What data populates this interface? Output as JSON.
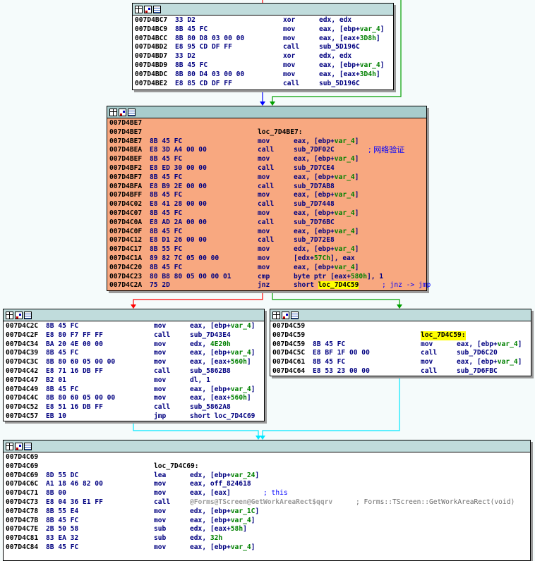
{
  "window": {
    "background": "#f5fbfb",
    "block_color": "#ffffff",
    "highlight_block_color": "#f8a880",
    "titlebar_color": "#c0dcdc"
  },
  "edge_colors": {
    "unconditional": "#0000ff",
    "taken": "#00a000",
    "not_taken": "#ff0000",
    "selected": "#00e8ff"
  },
  "blocks": [
    {
      "id": "block_7D4BC7",
      "lines": [
        {
          "addr": "007D4BC7",
          "bytes": "33 D2",
          "mnemonic": "xor",
          "operand": "edx, edx"
        },
        {
          "addr": "007D4BC9",
          "bytes": "8B 45 FC",
          "mnemonic": "mov",
          "operand": "eax, [ebp+var_4]"
        },
        {
          "addr": "007D4BCC",
          "bytes": "8B 80 D8 03 00 00",
          "mnemonic": "mov",
          "operand": "eax, [eax+3D8h]"
        },
        {
          "addr": "007D4BD2",
          "bytes": "E8 95 CD DF FF",
          "mnemonic": "call",
          "operand": "sub_5D196C"
        },
        {
          "addr": "007D4BD7",
          "bytes": "33 D2",
          "mnemonic": "xor",
          "operand": "edx, edx"
        },
        {
          "addr": "007D4BD9",
          "bytes": "8B 45 FC",
          "mnemonic": "mov",
          "operand": "eax, [ebp+var_4]"
        },
        {
          "addr": "007D4BDC",
          "bytes": "8B 80 D4 03 00 00",
          "mnemonic": "mov",
          "operand": "eax, [eax+3D4h]"
        },
        {
          "addr": "007D4BE2",
          "bytes": "E8 85 CD DF FF",
          "mnemonic": "call",
          "operand": "sub_5D196C"
        }
      ]
    },
    {
      "id": "block_7D4BE7",
      "lines": [
        {
          "addr": "007D4BE7"
        },
        {
          "addr": "007D4BE7",
          "label": "loc_7D4BE7:"
        },
        {
          "addr": "007D4BE7",
          "bytes": "8B 45 FC",
          "mnemonic": "mov",
          "operand": "eax, [ebp+var_4]"
        },
        {
          "addr": "007D4BEA",
          "bytes": "E8 3D A4 00 00",
          "mnemonic": "call",
          "operand": "sub_7DF02C",
          "comment": "; 网络验证"
        },
        {
          "addr": "007D4BEF",
          "bytes": "8B 45 FC",
          "mnemonic": "mov",
          "operand": "eax, [ebp+var_4]"
        },
        {
          "addr": "007D4BF2",
          "bytes": "E8 ED 30 00 00",
          "mnemonic": "call",
          "operand": "sub_7D7CE4"
        },
        {
          "addr": "007D4BF7",
          "bytes": "8B 45 FC",
          "mnemonic": "mov",
          "operand": "eax, [ebp+var_4]"
        },
        {
          "addr": "007D4BFA",
          "bytes": "E8 B9 2E 00 00",
          "mnemonic": "call",
          "operand": "sub_7D7AB8"
        },
        {
          "addr": "007D4BFF",
          "bytes": "8B 45 FC",
          "mnemonic": "mov",
          "operand": "eax, [ebp+var_4]"
        },
        {
          "addr": "007D4C02",
          "bytes": "E8 41 28 00 00",
          "mnemonic": "call",
          "operand": "sub_7D7448"
        },
        {
          "addr": "007D4C07",
          "bytes": "8B 45 FC",
          "mnemonic": "mov",
          "operand": "eax, [ebp+var_4]"
        },
        {
          "addr": "007D4C0A",
          "bytes": "E8 AD 2A 00 00",
          "mnemonic": "call",
          "operand": "sub_7D76BC"
        },
        {
          "addr": "007D4C0F",
          "bytes": "8B 45 FC",
          "mnemonic": "mov",
          "operand": "eax, [ebp+var_4]"
        },
        {
          "addr": "007D4C12",
          "bytes": "E8 D1 26 00 00",
          "mnemonic": "call",
          "operand": "sub_7D72E8"
        },
        {
          "addr": "007D4C17",
          "bytes": "8B 55 FC",
          "mnemonic": "mov",
          "operand": "edx, [ebp+var_4]"
        },
        {
          "addr": "007D4C1A",
          "bytes": "89 82 7C 05 00 00",
          "mnemonic": "mov",
          "operand": "[edx+57Ch], eax"
        },
        {
          "addr": "007D4C20",
          "bytes": "8B 45 FC",
          "mnemonic": "mov",
          "operand": "eax, [ebp+var_4]"
        },
        {
          "addr": "007D4C23",
          "bytes": "80 B8 80 05 00 00 01",
          "mnemonic": "cmp",
          "operand": "byte ptr [eax+580h], 1"
        },
        {
          "addr": "007D4C2A",
          "bytes": "75 2D",
          "mnemonic": "jnz",
          "operand": "short loc_7D4C59",
          "comment": "; jnz -> jmp"
        }
      ]
    },
    {
      "id": "block_7D4C2C",
      "lines": [
        {
          "addr": "007D4C2C",
          "bytes": "8B 45 FC",
          "mnemonic": "mov",
          "operand": "eax, [ebp+var_4]"
        },
        {
          "addr": "007D4C2F",
          "bytes": "E8 80 F7 FF FF",
          "mnemonic": "call",
          "operand": "sub_7D43E4"
        },
        {
          "addr": "007D4C34",
          "bytes": "BA 20 4E 00 00",
          "mnemonic": "mov",
          "operand": "edx, 4E20h"
        },
        {
          "addr": "007D4C39",
          "bytes": "8B 45 FC",
          "mnemonic": "mov",
          "operand": "eax, [ebp+var_4]"
        },
        {
          "addr": "007D4C3C",
          "bytes": "8B 80 60 05 00 00",
          "mnemonic": "mov",
          "operand": "eax, [eax+560h]"
        },
        {
          "addr": "007D4C42",
          "bytes": "E8 71 16 DB FF",
          "mnemonic": "call",
          "operand": "sub_5862B8"
        },
        {
          "addr": "007D4C47",
          "bytes": "B2 01",
          "mnemonic": "mov",
          "operand": "dl, 1"
        },
        {
          "addr": "007D4C49",
          "bytes": "8B 45 FC",
          "mnemonic": "mov",
          "operand": "eax, [ebp+var_4]"
        },
        {
          "addr": "007D4C4C",
          "bytes": "8B 80 60 05 00 00",
          "mnemonic": "mov",
          "operand": "eax, [eax+560h]"
        },
        {
          "addr": "007D4C52",
          "bytes": "E8 51 16 DB FF",
          "mnemonic": "call",
          "operand": "sub_5862A8"
        },
        {
          "addr": "007D4C57",
          "bytes": "EB 10",
          "mnemonic": "jmp",
          "operand": "short loc_7D4C69"
        }
      ]
    },
    {
      "id": "block_7D4C59",
      "lines": [
        {
          "addr": "007D4C59"
        },
        {
          "addr": "007D4C59",
          "label": "loc_7D4C59:"
        },
        {
          "addr": "007D4C59",
          "bytes": "8B 45 FC",
          "mnemonic": "mov",
          "operand": "eax, [ebp+var_4]"
        },
        {
          "addr": "007D4C5C",
          "bytes": "E8 BF 1F 00 00",
          "mnemonic": "call",
          "operand": "sub_7D6C20"
        },
        {
          "addr": "007D4C61",
          "bytes": "8B 45 FC",
          "mnemonic": "mov",
          "operand": "eax, [ebp+var_4]"
        },
        {
          "addr": "007D4C64",
          "bytes": "E8 53 23 00 00",
          "mnemonic": "call",
          "operand": "sub_7D6FBC"
        }
      ]
    },
    {
      "id": "block_7D4C69",
      "lines": [
        {
          "addr": "007D4C69"
        },
        {
          "addr": "007D4C69",
          "label": "loc_7D4C69:"
        },
        {
          "addr": "007D4C69",
          "bytes": "8D 55 DC",
          "mnemonic": "lea",
          "operand": "edx, [ebp+var_24]"
        },
        {
          "addr": "007D4C6C",
          "bytes": "A1 18 46 82 00",
          "mnemonic": "mov",
          "operand": "eax, off_824618"
        },
        {
          "addr": "007D4C71",
          "bytes": "8B 00",
          "mnemonic": "mov",
          "operand": "eax, [eax]",
          "comment": "; this"
        },
        {
          "addr": "007D4C73",
          "bytes": "E8 04 36 E1 FF",
          "mnemonic": "call",
          "operand": "@Forms@TScreen@GetWorkAreaRect$qqrv",
          "comment": "; Forms::TScreen::GetWorkAreaRect(void)"
        },
        {
          "addr": "007D4C78",
          "bytes": "8B 55 E4",
          "mnemonic": "mov",
          "operand": "edx, [ebp+var_1C]"
        },
        {
          "addr": "007D4C7B",
          "bytes": "8B 45 FC",
          "mnemonic": "mov",
          "operand": "eax, [ebp+var_4]"
        },
        {
          "addr": "007D4C7E",
          "bytes": "2B 50 58",
          "mnemonic": "sub",
          "operand": "edx, [eax+58h]"
        },
        {
          "addr": "007D4C81",
          "bytes": "83 EA 32",
          "mnemonic": "sub",
          "operand": "edx, 32h"
        },
        {
          "addr": "007D4C84",
          "bytes": "8B 45 FC",
          "mnemonic": "mov",
          "operand": "eax, [ebp+var_4]"
        }
      ]
    }
  ]
}
